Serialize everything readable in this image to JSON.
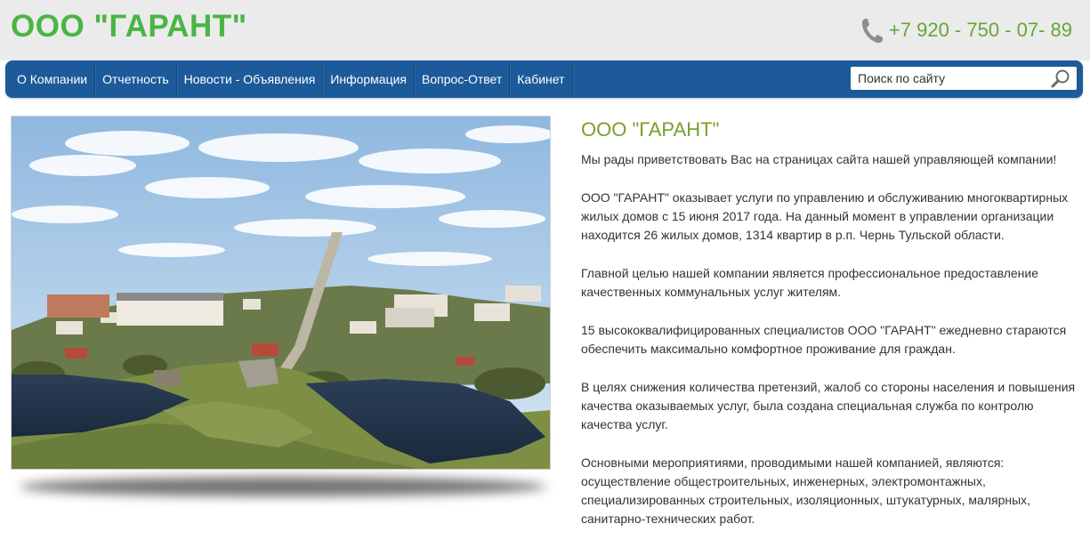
{
  "header": {
    "brand": "ООО \"ГАРАНТ\"",
    "phone": "+7 920 - 750 - 07- 89",
    "phone_icon": "phone-icon"
  },
  "nav": {
    "items": [
      {
        "label": "О Компании"
      },
      {
        "label": "Отчетность"
      },
      {
        "label": "Новости - Объявления"
      },
      {
        "label": "Информация"
      },
      {
        "label": "Вопрос-Ответ"
      },
      {
        "label": "Кабинет"
      }
    ],
    "search": {
      "placeholder": "Поиск по сайту",
      "value": "",
      "icon": "search-icon"
    }
  },
  "main": {
    "title": "ООО \"ГАРАНТ\"",
    "paragraphs": [
      "Мы рады приветствовать Вас на страницах сайта нашей управляющей компании!",
      "ООО \"ГАРАНТ\" оказывает услуги по управлению и обслуживанию  многоквартирных жилых домов  с 15 июня 2017 года. На данный момент в управлении организации находится 26 жилых домов, 1314 квартир в р.п. Чернь Тульской области.",
      "Главной целью нашей компании является профессиональное предоставление качественных коммунальных услуг жителям.",
      "15 высококвалифицированных специалистов ООО \"ГАРАНТ\" ежедневно стараются обеспечить максимально комфортное проживание для граждан.",
      "В целях снижения количества претензий, жалоб со стороны населения и повышения качества оказываемых услуг, была создана специальная служба по контролю качества услуг.",
      "Основными мероприятиями, проводимыми нашей компанией, являются: осуществление общестроительных, инженерных, электромонтажных, специализированных строительных, изоляционных, штукатурных, малярных, санитарно-технических работ."
    ]
  },
  "colors": {
    "brand_green": "#49b545",
    "nav_blue": "#1c5a9a",
    "title_olive": "#7a9f2c",
    "phone_green": "#64a63a"
  }
}
